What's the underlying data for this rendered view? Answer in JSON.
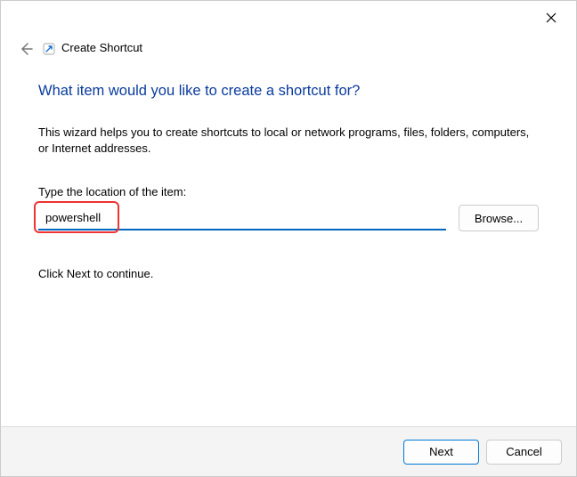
{
  "window": {
    "title": "Create Shortcut"
  },
  "heading": "What item would you like to create a shortcut for?",
  "description": "This wizard helps you to create shortcuts to local or network programs, files, folders, computers, or Internet addresses.",
  "field": {
    "label": "Type the location of the item:",
    "value": "powershell"
  },
  "buttons": {
    "browse": "Browse...",
    "next": "Next",
    "cancel": "Cancel"
  },
  "continue_text": "Click Next to continue."
}
